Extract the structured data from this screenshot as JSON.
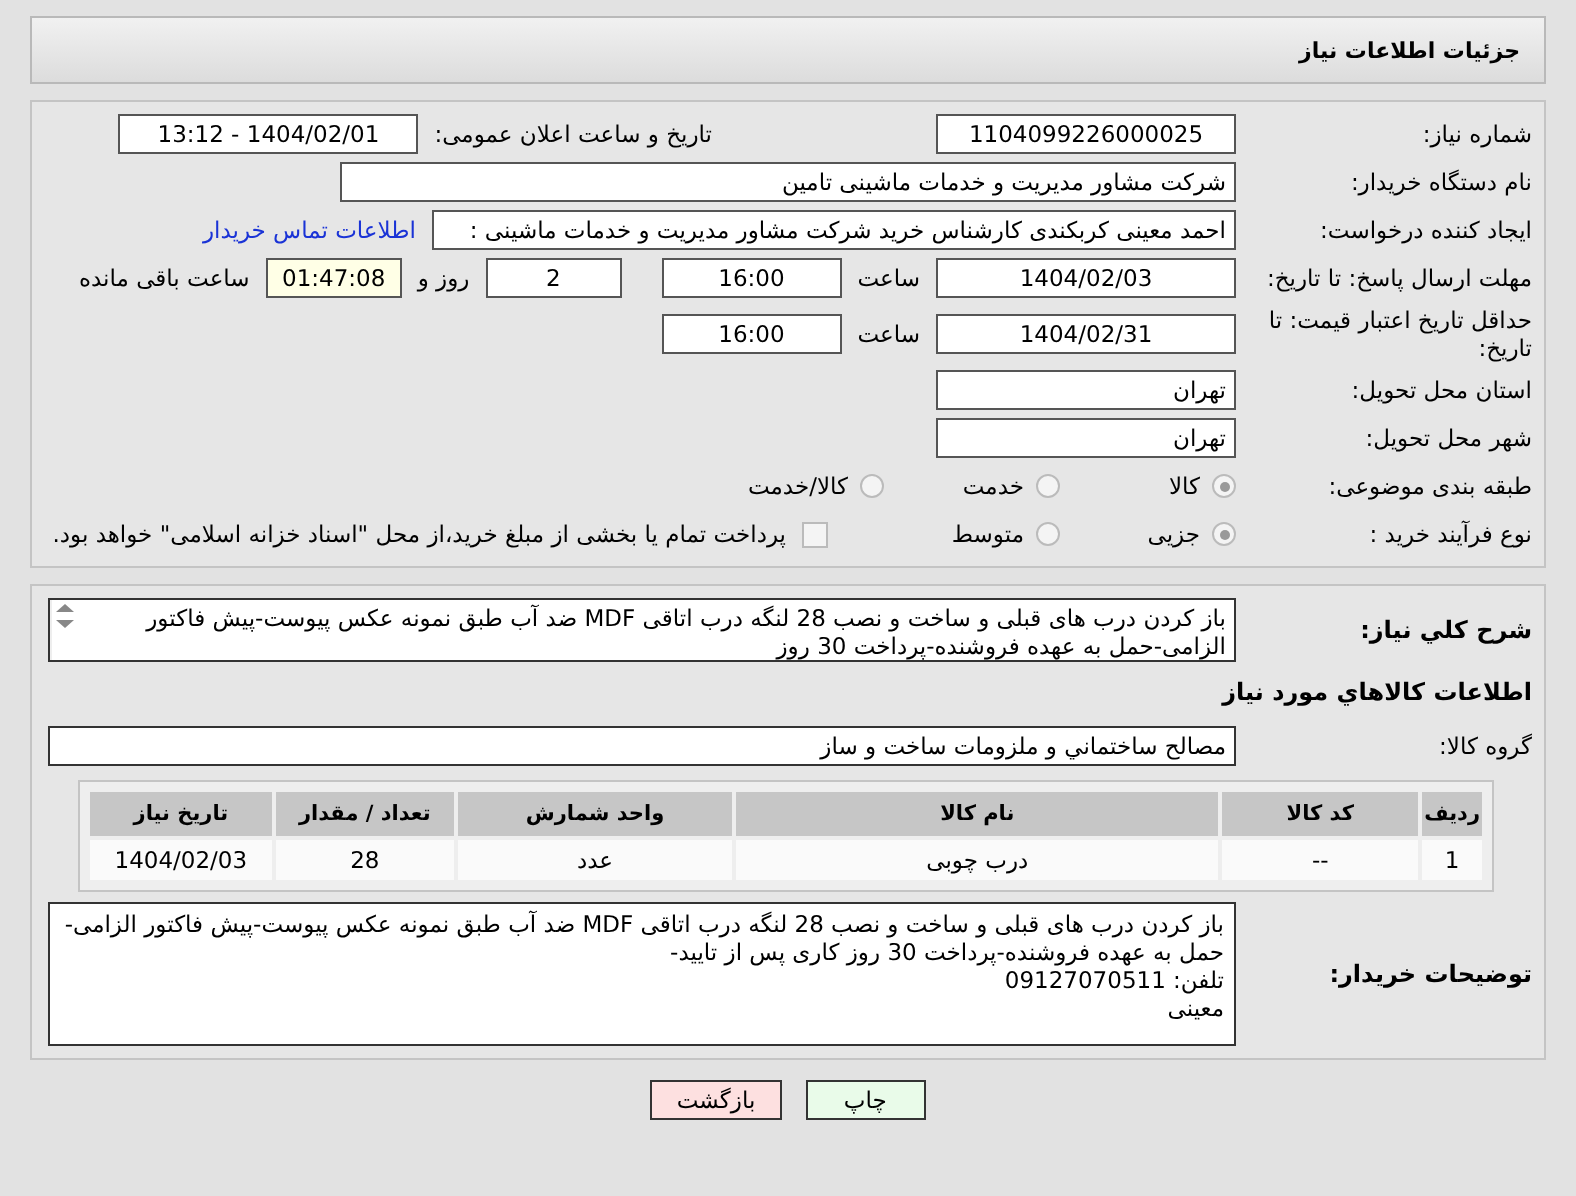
{
  "header": {
    "title": "جزئیات اطلاعات نیاز"
  },
  "need_number": {
    "label": "شماره نیاز:",
    "value": "1104099226000025"
  },
  "announce": {
    "label": "تاریخ و ساعت اعلان عمومی:",
    "value": "1404/02/01 - 13:12"
  },
  "buyer_org": {
    "label": "نام دستگاه خریدار:",
    "value": "شرکت مشاور مدیریت و خدمات ماشینی تامین"
  },
  "requester": {
    "label": "ایجاد کننده درخواست:",
    "value": "احمد معینی کربکندی کارشناس خرید شرکت مشاور مدیریت و خدمات ماشینی :",
    "link": "اطلاعات تماس خریدار"
  },
  "reply_deadline": {
    "label": "مهلت ارسال پاسخ: تا تاریخ:",
    "date": "1404/02/03",
    "time_label": "ساعت",
    "time": "16:00",
    "days": "2",
    "days_label": "روز و",
    "remaining": "01:47:08",
    "remaining_label": "ساعت باقی مانده"
  },
  "price_validity": {
    "label": "حداقل تاریخ اعتبار قیمت: تا تاریخ:",
    "date": "1404/02/31",
    "time_label": "ساعت",
    "time": "16:00"
  },
  "province": {
    "label": "استان محل تحویل:",
    "value": "تهران"
  },
  "city": {
    "label": "شهر محل تحویل:",
    "value": "تهران"
  },
  "category": {
    "label": "طبقه بندی موضوعی:",
    "options": [
      {
        "label": "کالا",
        "selected": true
      },
      {
        "label": "خدمت",
        "selected": false
      },
      {
        "label": "کالا/خدمت",
        "selected": false
      }
    ]
  },
  "purchase_type": {
    "label": "نوع فرآیند خرید :",
    "options": [
      {
        "label": "جزیی",
        "selected": true
      },
      {
        "label": "متوسط",
        "selected": false
      }
    ],
    "payment_note": {
      "label": "پرداخت تمام یا بخشی از مبلغ خرید،از محل \"اسناد خزانه اسلامی\" خواهد بود.",
      "checked": false
    }
  },
  "description": {
    "label": "شرح کلي نياز:",
    "value": "باز کردن درب های قبلی و ساخت و نصب 28 لنگه درب اتاقی MDF ضد آب طبق نمونه عکس پیوست-پیش فاکتور الزامی-حمل به عهده فروشنده-پرداخت 30 روز"
  },
  "goods_heading": "اطلاعات کالاهاي مورد نياز",
  "goods_group": {
    "label": "گروه کالا:",
    "value": "مصالح ساختماني و ملزومات ساخت و ساز"
  },
  "table": {
    "columns": [
      "رديف",
      "کد کالا",
      "نام کالا",
      "واحد شمارش",
      "تعداد / مقدار",
      "تاریخ نیاز"
    ],
    "rows": [
      [
        "1",
        "--",
        "درب چوبی",
        "عدد",
        "28",
        "1404/02/03"
      ]
    ]
  },
  "buyer_notes": {
    "label": "توضیحات خریدار:",
    "value": "باز کردن درب های قبلی و ساخت و نصب 28 لنگه درب اتاقی MDF ضد آب طبق نمونه عکس پیوست-پیش فاکتور الزامی-حمل به عهده فروشنده-پرداخت 30 روز کاری پس از تایید-\nتلفن: 09127070511\nمعینی"
  },
  "buttons": [
    {
      "label": "چاپ",
      "kind": "print"
    },
    {
      "label": "بازگشت",
      "kind": "back"
    }
  ]
}
